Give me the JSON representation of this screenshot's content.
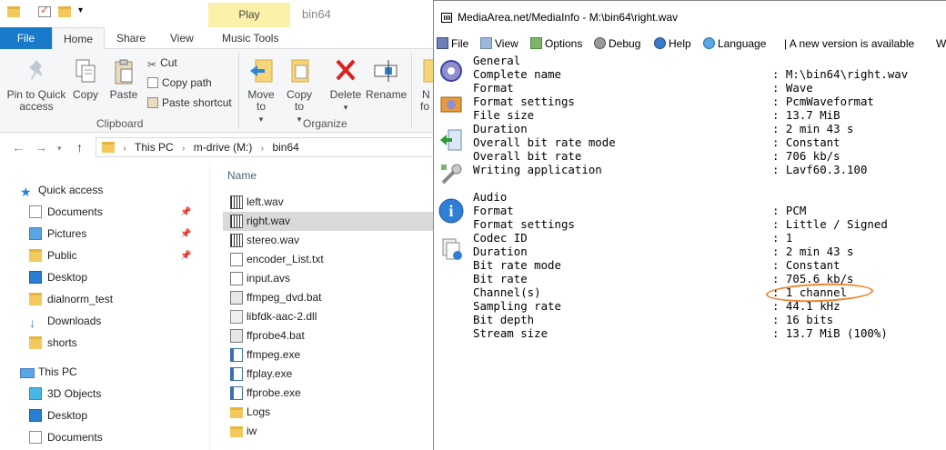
{
  "explorer": {
    "window_title": "bin64",
    "context_tab": "Play",
    "tabs": {
      "file": "File",
      "home": "Home",
      "share": "Share",
      "view": "View",
      "music_tools": "Music Tools"
    },
    "ribbon": {
      "pin_to_quick_access": "Pin to Quick access",
      "copy": "Copy",
      "paste": "Paste",
      "cut": "Cut",
      "copy_path": "Copy path",
      "paste_shortcut": "Paste shortcut",
      "clipboard_group": "Clipboard",
      "move_to": "Move to",
      "copy_to": "Copy to",
      "delete": "Delete",
      "rename": "Rename",
      "new_partial_1": "N",
      "new_partial_2": "fo",
      "organize_group": "Organize"
    },
    "address": {
      "crumbs": [
        "This PC",
        "m-drive (M:)",
        "bin64"
      ]
    },
    "nav": {
      "quick_access": "Quick access",
      "documents": "Documents",
      "pictures": "Pictures",
      "public": "Public",
      "desktop": "Desktop",
      "dialnorm_test": "dialnorm_test",
      "downloads": "Downloads",
      "shorts": "shorts",
      "this_pc": "This PC",
      "objects_3d": "3D Objects",
      "desktop2": "Desktop",
      "documents2": "Documents"
    },
    "columns": {
      "name": "Name"
    },
    "files": [
      {
        "name": "left.wav",
        "type": "wav"
      },
      {
        "name": "right.wav",
        "type": "wav",
        "selected": true
      },
      {
        "name": "stereo.wav",
        "type": "wav"
      },
      {
        "name": "encoder_List.txt",
        "type": "txt"
      },
      {
        "name": "input.avs",
        "type": "avs"
      },
      {
        "name": "ffmpeg_dvd.bat",
        "type": "bat"
      },
      {
        "name": "libfdk-aac-2.dll",
        "type": "dll"
      },
      {
        "name": "ffprobe4.bat",
        "type": "bat"
      },
      {
        "name": "ffmpeg.exe",
        "type": "exe"
      },
      {
        "name": "ffplay.exe",
        "type": "exe"
      },
      {
        "name": "ffprobe.exe",
        "type": "exe"
      },
      {
        "name": "Logs",
        "type": "folder"
      },
      {
        "name": "iw",
        "type": "folder"
      }
    ]
  },
  "mediainfo": {
    "title": "MediaArea.net/MediaInfo - M:\\bin64\\right.wav",
    "menu": {
      "file": "File",
      "view": "View",
      "options": "Options",
      "debug": "Debug",
      "help": "Help",
      "language": "Language",
      "notice": "| A new version is available",
      "trailing": "W"
    },
    "general_header": "General",
    "general": [
      {
        "k": "Complete name",
        "v": ": M:\\bin64\\right.wav"
      },
      {
        "k": "Format",
        "v": ": Wave"
      },
      {
        "k": "Format settings",
        "v": ": PcmWaveformat"
      },
      {
        "k": "File size",
        "v": ": 13.7 MiB"
      },
      {
        "k": "Duration",
        "v": ": 2 min 43 s"
      },
      {
        "k": "Overall bit rate mode",
        "v": ": Constant"
      },
      {
        "k": "Overall bit rate",
        "v": ": 706 kb/s"
      },
      {
        "k": "Writing application",
        "v": ": Lavf60.3.100"
      }
    ],
    "audio_header": "Audio",
    "audio": [
      {
        "k": "Format",
        "v": ": PCM"
      },
      {
        "k": "Format settings",
        "v": ": Little / Signed"
      },
      {
        "k": "Codec ID",
        "v": ": 1"
      },
      {
        "k": "Duration",
        "v": ": 2 min 43 s"
      },
      {
        "k": "Bit rate mode",
        "v": ": Constant"
      },
      {
        "k": "Bit rate",
        "v": ": 705.6 kb/s"
      },
      {
        "k": "Channel(s)",
        "v": ": 1 channel"
      },
      {
        "k": "Sampling rate",
        "v": ": 44.1 kHz"
      },
      {
        "k": "Bit depth",
        "v": ": 16 bits"
      },
      {
        "k": "Stream size",
        "v": ": 13.7 MiB (100%)"
      }
    ],
    "annotation_color": "#f0822e"
  }
}
